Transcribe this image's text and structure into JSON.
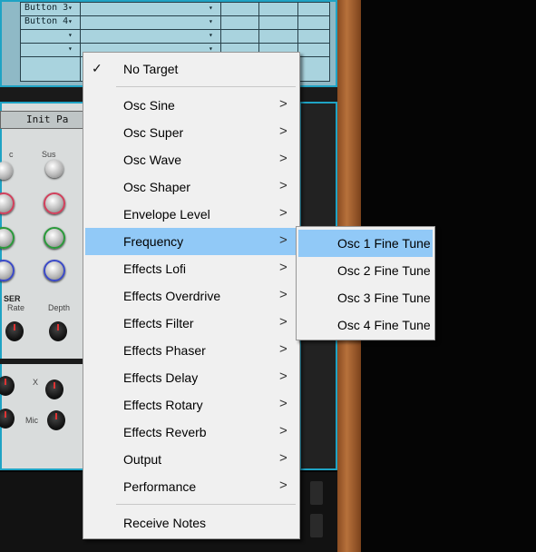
{
  "background": {
    "lcd_rows": [
      "Button 3",
      "Button 4",
      "",
      ""
    ],
    "patch_name": "Init Pa",
    "knob_labels": [
      "c",
      "Sus"
    ],
    "phaser_labels": [
      "SER",
      "Rate",
      "Depth"
    ],
    "x_label": "X",
    "mic_label": "Mic"
  },
  "menu": {
    "items": [
      {
        "label": "No Target",
        "checked": true,
        "submenu": false
      },
      {
        "label": "Osc Sine",
        "submenu": true
      },
      {
        "label": "Osc Super",
        "submenu": true
      },
      {
        "label": "Osc Wave",
        "submenu": true
      },
      {
        "label": "Osc Shaper",
        "submenu": true
      },
      {
        "label": "Envelope Level",
        "submenu": true
      },
      {
        "label": "Frequency",
        "submenu": true,
        "highlighted": true
      },
      {
        "label": "Effects Lofi",
        "submenu": true
      },
      {
        "label": "Effects Overdrive",
        "submenu": true
      },
      {
        "label": "Effects Filter",
        "submenu": true
      },
      {
        "label": "Effects Phaser",
        "submenu": true
      },
      {
        "label": "Effects Delay",
        "submenu": true
      },
      {
        "label": "Effects Rotary",
        "submenu": true
      },
      {
        "label": "Effects Reverb",
        "submenu": true
      },
      {
        "label": "Output",
        "submenu": true
      },
      {
        "label": "Performance",
        "submenu": true
      },
      {
        "label": "Receive Notes",
        "submenu": false
      }
    ],
    "check_glyph": "✓",
    "arrow_glyph": ">"
  },
  "submenu": {
    "items": [
      {
        "label": "Osc 1 Fine Tune",
        "highlighted": true
      },
      {
        "label": "Osc 2 Fine Tune"
      },
      {
        "label": "Osc 3 Fine Tune"
      },
      {
        "label": "Osc 4 Fine Tune"
      }
    ]
  },
  "colors": {
    "highlight": "#91c9f7",
    "menu_bg": "#f0f0f0",
    "lcd": "#a9d3de",
    "accent_border": "#1fa3c4",
    "wood": "#b7713b"
  }
}
